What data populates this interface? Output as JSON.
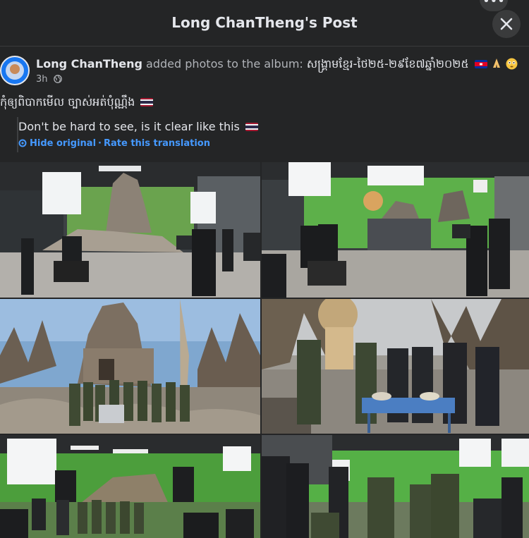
{
  "topbar": {
    "title": "Long ChanTheng's Post",
    "more_label": "•••"
  },
  "post": {
    "author": "Long ChanTheng",
    "action": "added photos to the album:",
    "album_title": "សង្គ្រាមខ្មែរ-ថៃ២៥-២៩ខែ៧ឆ្នាំ២០២៥",
    "album_emojis": [
      "flag-cambodia-icon",
      "praying-hands-icon",
      "flushed-face-icon"
    ],
    "time": "3h",
    "caption": "កុំឲ្យពិបាកមើល ច្បាស់អត់បុំណ្ណឹង",
    "caption_emoji": "flag-thailand-icon",
    "translation": {
      "text": "Don't be hard to see, is it clear like this",
      "text_emoji": "flag-thailand-icon",
      "hide_label": "Hide original",
      "separator": "·",
      "rate_label": "Rate this translation"
    }
  },
  "photos": [
    {
      "name": "film-set-temple-studio"
    },
    {
      "name": "film-set-greenscreen-crew"
    },
    {
      "name": "temple-ruins-soldiers"
    },
    {
      "name": "soldiers-at-table"
    },
    {
      "name": "greenscreen-wide-stage"
    },
    {
      "name": "crew-and-soldiers-greenscreen"
    }
  ],
  "colors": {
    "background": "#242526",
    "link": "#4599ff",
    "muted": "#b0b3b8",
    "text": "#e4e6eb"
  }
}
